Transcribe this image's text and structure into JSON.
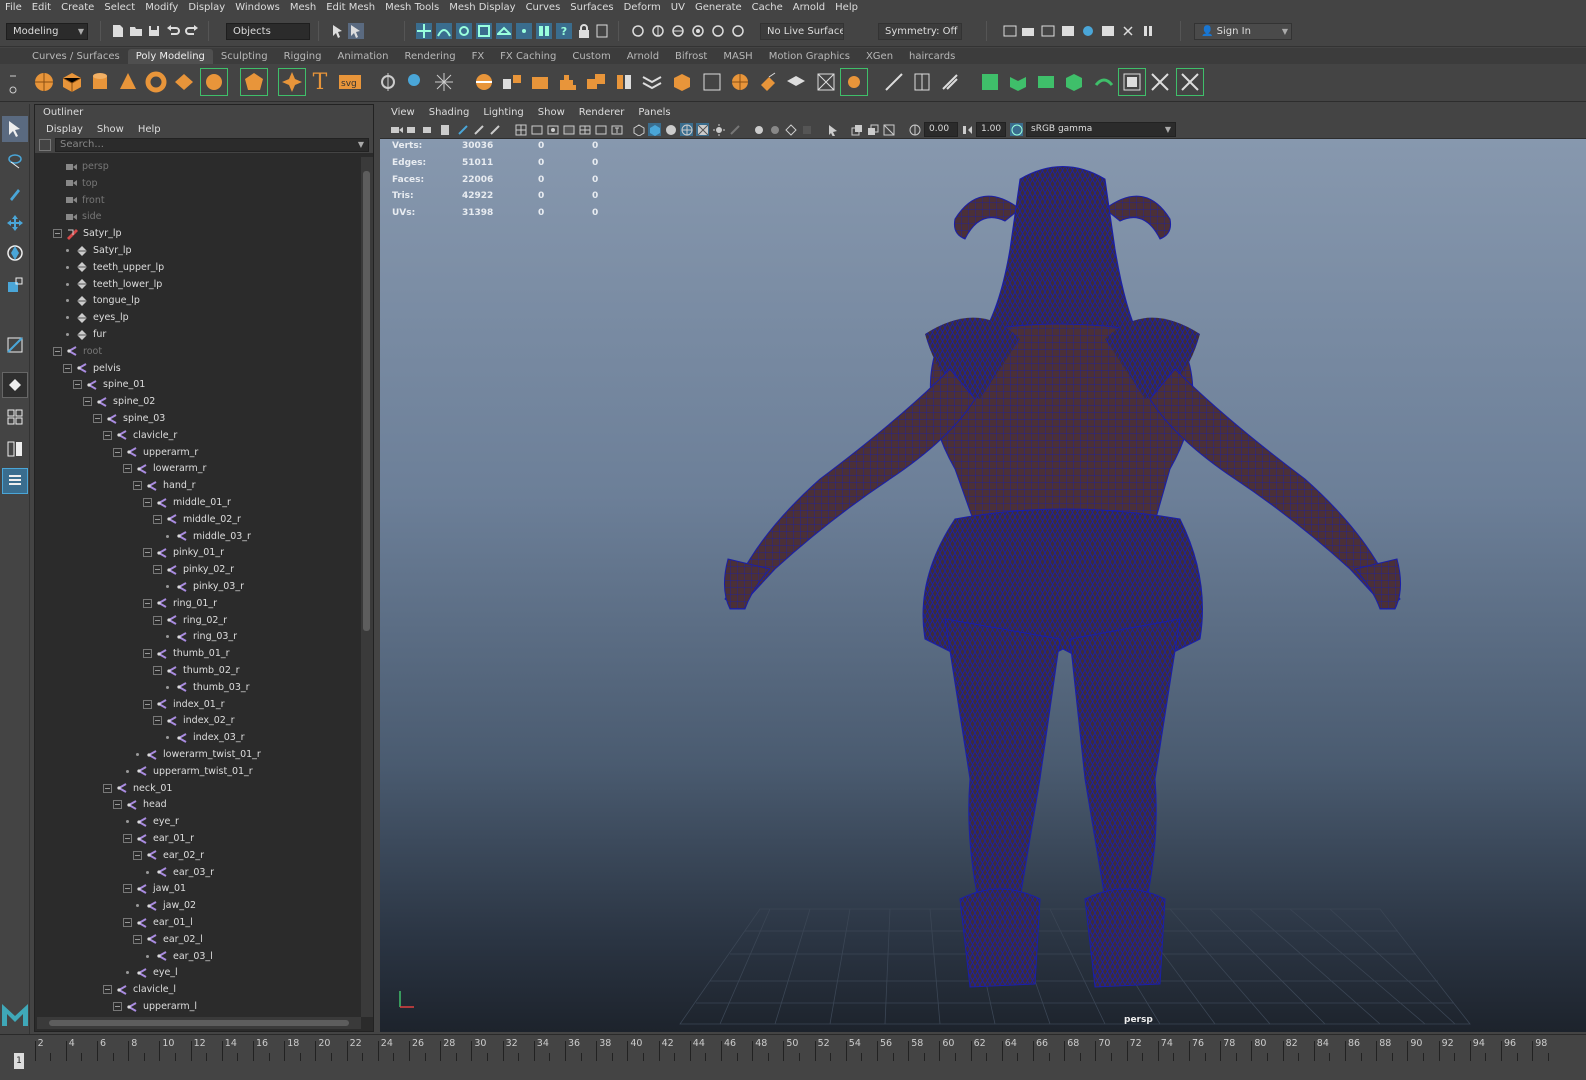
{
  "menubar": [
    "File",
    "Edit",
    "Create",
    "Select",
    "Modify",
    "Display",
    "Windows",
    "Mesh",
    "Edit Mesh",
    "Mesh Tools",
    "Mesh Display",
    "Curves",
    "Surfaces",
    "Deform",
    "UV",
    "Generate",
    "Cache",
    "Arnold",
    "Help"
  ],
  "status": {
    "mode": "Modeling",
    "selection_mode": "Objects",
    "live_surface": "No Live Surface",
    "symmetry": "Symmetry: Off",
    "sign_in": "Sign In"
  },
  "shelf_tabs": [
    "Curves / Surfaces",
    "Poly Modeling",
    "Sculpting",
    "Rigging",
    "Animation",
    "Rendering",
    "FX",
    "FX Caching",
    "Custom",
    "Arnold",
    "Bifrost",
    "MASH",
    "Motion Graphics",
    "XGen",
    "haircards"
  ],
  "shelf_active": "Poly Modeling",
  "outliner": {
    "title": "Outliner",
    "menu": [
      "Display",
      "Show",
      "Help"
    ],
    "search_placeholder": "Search...",
    "items": [
      {
        "label": "persp",
        "depth": 0,
        "kind": "camera",
        "dim": true
      },
      {
        "label": "top",
        "depth": 0,
        "kind": "camera",
        "dim": true
      },
      {
        "label": "front",
        "depth": 0,
        "kind": "camera",
        "dim": true
      },
      {
        "label": "side",
        "depth": 0,
        "kind": "camera",
        "dim": true
      },
      {
        "label": "Satyr_lp",
        "depth": 0,
        "kind": "group",
        "expanded": true
      },
      {
        "label": "Satyr_lp",
        "depth": 1,
        "kind": "mesh"
      },
      {
        "label": "teeth_upper_lp",
        "depth": 1,
        "kind": "mesh"
      },
      {
        "label": "teeth_lower_lp",
        "depth": 1,
        "kind": "mesh"
      },
      {
        "label": "tongue_lp",
        "depth": 1,
        "kind": "mesh"
      },
      {
        "label": "eyes_lp",
        "depth": 1,
        "kind": "mesh"
      },
      {
        "label": "fur",
        "depth": 1,
        "kind": "mesh"
      },
      {
        "label": "root",
        "depth": 0,
        "kind": "joint",
        "expanded": true,
        "dim": true
      },
      {
        "label": "pelvis",
        "depth": 1,
        "kind": "joint",
        "expanded": true
      },
      {
        "label": "spine_01",
        "depth": 2,
        "kind": "joint",
        "expanded": true
      },
      {
        "label": "spine_02",
        "depth": 3,
        "kind": "joint",
        "expanded": true
      },
      {
        "label": "spine_03",
        "depth": 4,
        "kind": "joint",
        "expanded": true
      },
      {
        "label": "clavicle_r",
        "depth": 5,
        "kind": "joint",
        "expanded": true
      },
      {
        "label": "upperarm_r",
        "depth": 6,
        "kind": "joint",
        "expanded": true
      },
      {
        "label": "lowerarm_r",
        "depth": 7,
        "kind": "joint",
        "expanded": true
      },
      {
        "label": "hand_r",
        "depth": 8,
        "kind": "joint",
        "expanded": true
      },
      {
        "label": "middle_01_r",
        "depth": 9,
        "kind": "joint",
        "expanded": true
      },
      {
        "label": "middle_02_r",
        "depth": 10,
        "kind": "joint",
        "expanded": true
      },
      {
        "label": "middle_03_r",
        "depth": 11,
        "kind": "joint"
      },
      {
        "label": "pinky_01_r",
        "depth": 9,
        "kind": "joint",
        "expanded": true
      },
      {
        "label": "pinky_02_r",
        "depth": 10,
        "kind": "joint",
        "expanded": true
      },
      {
        "label": "pinky_03_r",
        "depth": 11,
        "kind": "joint"
      },
      {
        "label": "ring_01_r",
        "depth": 9,
        "kind": "joint",
        "expanded": true
      },
      {
        "label": "ring_02_r",
        "depth": 10,
        "kind": "joint",
        "expanded": true
      },
      {
        "label": "ring_03_r",
        "depth": 11,
        "kind": "joint"
      },
      {
        "label": "thumb_01_r",
        "depth": 9,
        "kind": "joint",
        "expanded": true
      },
      {
        "label": "thumb_02_r",
        "depth": 10,
        "kind": "joint",
        "expanded": true
      },
      {
        "label": "thumb_03_r",
        "depth": 11,
        "kind": "joint"
      },
      {
        "label": "index_01_r",
        "depth": 9,
        "kind": "joint",
        "expanded": true
      },
      {
        "label": "index_02_r",
        "depth": 10,
        "kind": "joint",
        "expanded": true
      },
      {
        "label": "index_03_r",
        "depth": 11,
        "kind": "joint"
      },
      {
        "label": "lowerarm_twist_01_r",
        "depth": 8,
        "kind": "joint"
      },
      {
        "label": "upperarm_twist_01_r",
        "depth": 7,
        "kind": "joint"
      },
      {
        "label": "neck_01",
        "depth": 5,
        "kind": "joint",
        "expanded": true
      },
      {
        "label": "head",
        "depth": 6,
        "kind": "joint",
        "expanded": true
      },
      {
        "label": "eye_r",
        "depth": 7,
        "kind": "joint"
      },
      {
        "label": "ear_01_r",
        "depth": 7,
        "kind": "joint",
        "expanded": true
      },
      {
        "label": "ear_02_r",
        "depth": 8,
        "kind": "joint",
        "expanded": true
      },
      {
        "label": "ear_03_r",
        "depth": 9,
        "kind": "joint"
      },
      {
        "label": "jaw_01",
        "depth": 7,
        "kind": "joint",
        "expanded": true
      },
      {
        "label": "jaw_02",
        "depth": 8,
        "kind": "joint"
      },
      {
        "label": "ear_01_l",
        "depth": 7,
        "kind": "joint",
        "expanded": true
      },
      {
        "label": "ear_02_l",
        "depth": 8,
        "kind": "joint",
        "expanded": true
      },
      {
        "label": "ear_03_l",
        "depth": 9,
        "kind": "joint"
      },
      {
        "label": "eye_l",
        "depth": 7,
        "kind": "joint"
      },
      {
        "label": "clavicle_l",
        "depth": 5,
        "kind": "joint",
        "expanded": true
      },
      {
        "label": "upperarm_l",
        "depth": 6,
        "kind": "joint",
        "expanded": true
      }
    ]
  },
  "panel": {
    "menu": [
      "View",
      "Shading",
      "Lighting",
      "Show",
      "Renderer",
      "Panels"
    ],
    "exposure": "0.00",
    "gamma": "1.00",
    "colorspace": "sRGB gamma"
  },
  "hud": [
    {
      "label": "Verts:",
      "v1": "30036",
      "v2": "0",
      "v3": "0"
    },
    {
      "label": "Edges:",
      "v1": "51011",
      "v2": "0",
      "v3": "0"
    },
    {
      "label": "Faces:",
      "v1": "22006",
      "v2": "0",
      "v3": "0"
    },
    {
      "label": "Tris:",
      "v1": "42922",
      "v2": "0",
      "v3": "0"
    },
    {
      "label": "UVs:",
      "v1": "31398",
      "v2": "0",
      "v3": "0"
    }
  ],
  "camera_label": "persp",
  "timeline": {
    "current": "1",
    "labels": [
      "2",
      "4",
      "6",
      "8",
      "10",
      "12",
      "14",
      "16",
      "18",
      "20",
      "22",
      "24",
      "26",
      "28",
      "30",
      "32",
      "34",
      "36",
      "38",
      "40",
      "42",
      "44",
      "46",
      "48",
      "50",
      "52",
      "54",
      "56",
      "58",
      "60",
      "62",
      "64",
      "66",
      "68",
      "70",
      "72",
      "74",
      "76",
      "78",
      "80",
      "82",
      "84",
      "86",
      "88",
      "90",
      "92",
      "94",
      "96",
      "98"
    ]
  },
  "colors": {
    "accent_orange": "#e8953a",
    "accent_green": "#3fbf6a",
    "accent_blue": "#4aa6d8",
    "wire": "#1a1fa8"
  }
}
